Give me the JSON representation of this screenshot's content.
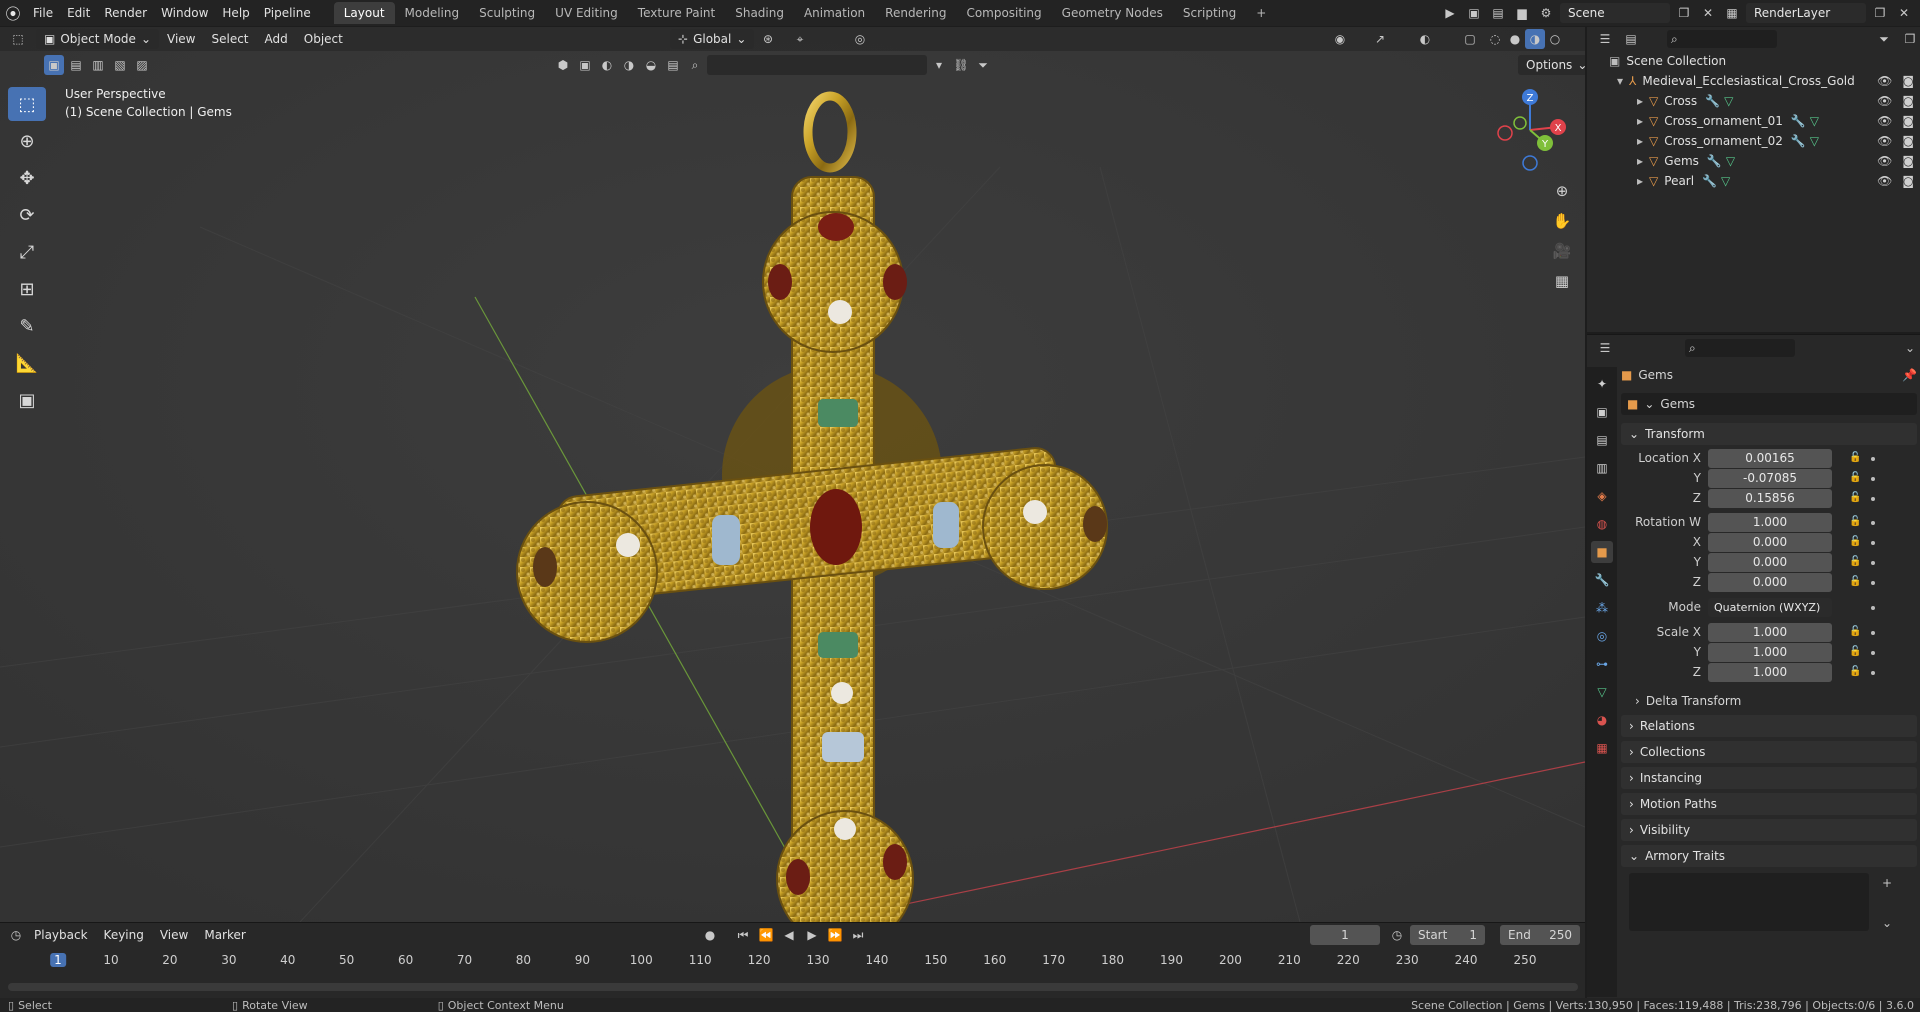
{
  "topbar": {
    "menus": [
      "File",
      "Edit",
      "Render",
      "Window",
      "Help",
      "Pipeline"
    ],
    "workspaces": [
      "Layout",
      "Modeling",
      "Sculpting",
      "UV Editing",
      "Texture Paint",
      "Shading",
      "Animation",
      "Rendering",
      "Compositing",
      "Geometry Nodes",
      "Scripting"
    ],
    "active_workspace": "Layout",
    "add_tab": "+",
    "scene": "Scene",
    "render_layer": "RenderLayer"
  },
  "viewport": {
    "mode": "Object Mode",
    "menus": [
      "View",
      "Select",
      "Add",
      "Object"
    ],
    "transform_orientation": "Global",
    "options_label": "Options",
    "info_line1": "User Perspective",
    "info_line2": "(1) Scene Collection | Gems",
    "axis_labels": {
      "x": "X",
      "y": "Y",
      "z": "Z"
    }
  },
  "timeline": {
    "menus": [
      "Playback",
      "Keying",
      "View",
      "Marker"
    ],
    "current_frame": "1",
    "start_label": "Start",
    "start_value": "1",
    "end_label": "End",
    "end_value": "250",
    "ticks": [
      "1",
      "10",
      "20",
      "30",
      "40",
      "50",
      "60",
      "70",
      "80",
      "90",
      "100",
      "110",
      "120",
      "130",
      "140",
      "150",
      "160",
      "170",
      "180",
      "190",
      "200",
      "210",
      "220",
      "230",
      "240",
      "250"
    ]
  },
  "outliner": {
    "root": "Scene Collection",
    "parent": "Medieval_Ecclesiastical_Cross_Gold",
    "children": [
      "Cross",
      "Cross_ornament_01",
      "Cross_ornament_02",
      "Gems",
      "Pearl"
    ]
  },
  "properties": {
    "object_name": "Gems",
    "data_name": "Gems",
    "transform_title": "Transform",
    "location_label": "Location X",
    "location": {
      "x": "0.00165",
      "y": "-0.07085",
      "z": "0.15856"
    },
    "rotation_label": "Rotation W",
    "rotation": {
      "w": "1.000",
      "x": "0.000",
      "y": "0.000",
      "z": "0.000"
    },
    "mode_label": "Mode",
    "mode_value": "Quaternion (WXYZ)",
    "scale_label": "Scale X",
    "scale": {
      "x": "1.000",
      "y": "1.000",
      "z": "1.000"
    },
    "axis_y": "Y",
    "axis_z": "Z",
    "axis_x": "X",
    "delta_transform": "Delta Transform",
    "sections": [
      "Relations",
      "Collections",
      "Instancing",
      "Motion Paths",
      "Visibility"
    ],
    "armory_traits": "Armory Traits"
  },
  "status": {
    "select": "Select",
    "rotate": "Rotate View",
    "context": "Object Context Menu",
    "stats": "Scene Collection | Gems | Verts:130,950 | Faces:119,488 | Tris:238,796 | Objects:0/6 | 3.6.0"
  },
  "colors": {
    "accent": "#4772b3",
    "x_axis": "#e0424b",
    "y_axis": "#7fbf3a",
    "z_axis": "#3e7ad8",
    "gold": "#c9a227"
  }
}
